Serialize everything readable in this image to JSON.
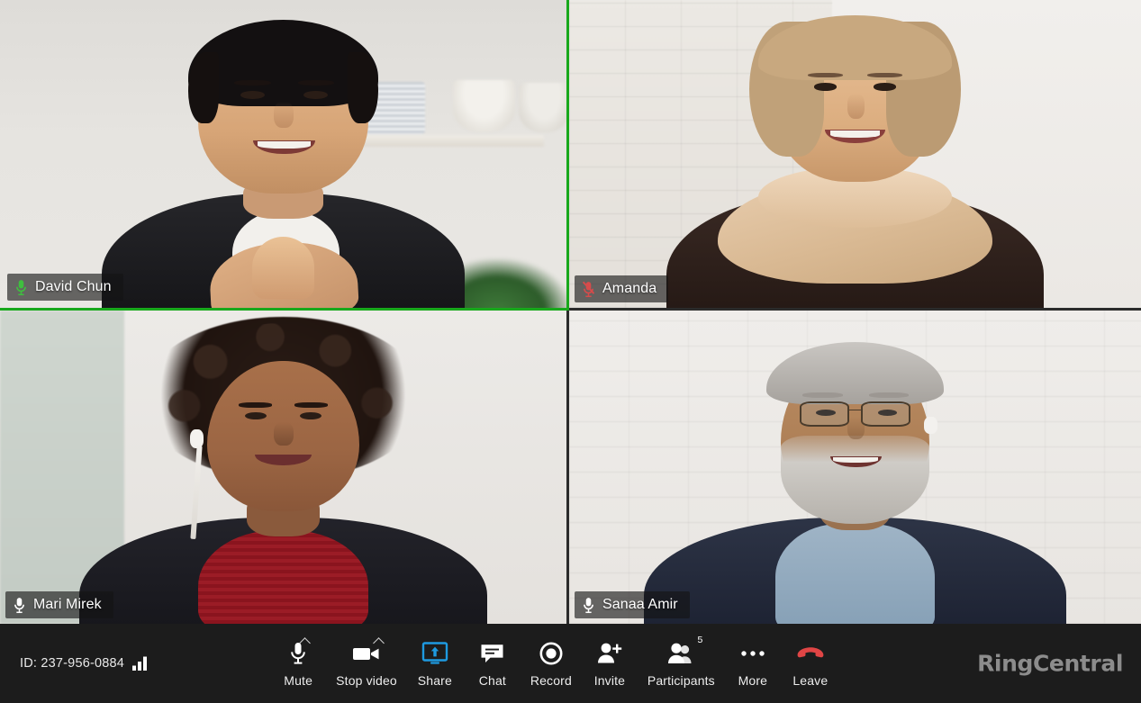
{
  "app": {
    "name": "RingCentral Video",
    "brand_label": "RingCentral",
    "brand_color": "#8c8c8c",
    "background_color": "#1c1c1c"
  },
  "meeting": {
    "id_label": "ID: 237-956-0884",
    "signal_icon": "signal-bars-icon",
    "signal_bars": 3,
    "active_speaker_color": "#18a81c"
  },
  "participants": [
    {
      "name": "David Chun",
      "mic_icon": "microphone-icon",
      "mic_state": "speaking",
      "mic_color": "#3fbf3f",
      "active_speaker": true,
      "position": "top-left"
    },
    {
      "name": "Amanda",
      "mic_icon": "microphone-muted-icon",
      "mic_state": "muted",
      "mic_color": "#d64b4b",
      "active_speaker": false,
      "position": "top-right"
    },
    {
      "name": "Mari Mirek",
      "mic_icon": "microphone-icon",
      "mic_state": "unmuted",
      "mic_color": "#ffffff",
      "active_speaker": false,
      "position": "bottom-left"
    },
    {
      "name": "Sanaa Amir",
      "mic_icon": "microphone-icon",
      "mic_state": "unmuted",
      "mic_color": "#ffffff",
      "active_speaker": false,
      "position": "bottom-right"
    }
  ],
  "toolbar": {
    "controls": [
      {
        "label": "Mute",
        "icon": "microphone-icon",
        "has_chevron": true,
        "badge": null,
        "accent": "#ffffff"
      },
      {
        "label": "Stop video",
        "icon": "video-camera-icon",
        "has_chevron": true,
        "badge": null,
        "accent": "#ffffff"
      },
      {
        "label": "Share",
        "icon": "screen-share-icon",
        "has_chevron": false,
        "badge": null,
        "accent": "#1e9ae0"
      },
      {
        "label": "Chat",
        "icon": "chat-bubble-icon",
        "has_chevron": false,
        "badge": null,
        "accent": "#ffffff"
      },
      {
        "label": "Record",
        "icon": "record-circle-icon",
        "has_chevron": false,
        "badge": null,
        "accent": "#ffffff"
      },
      {
        "label": "Invite",
        "icon": "person-add-icon",
        "has_chevron": false,
        "badge": null,
        "accent": "#ffffff"
      },
      {
        "label": "Participants",
        "icon": "people-icon",
        "has_chevron": false,
        "badge": "5",
        "accent": "#ffffff"
      },
      {
        "label": "More",
        "icon": "ellipsis-icon",
        "has_chevron": false,
        "badge": null,
        "accent": "#ffffff"
      },
      {
        "label": "Leave",
        "icon": "hangup-phone-icon",
        "has_chevron": false,
        "badge": null,
        "accent": "#e04545"
      }
    ]
  }
}
